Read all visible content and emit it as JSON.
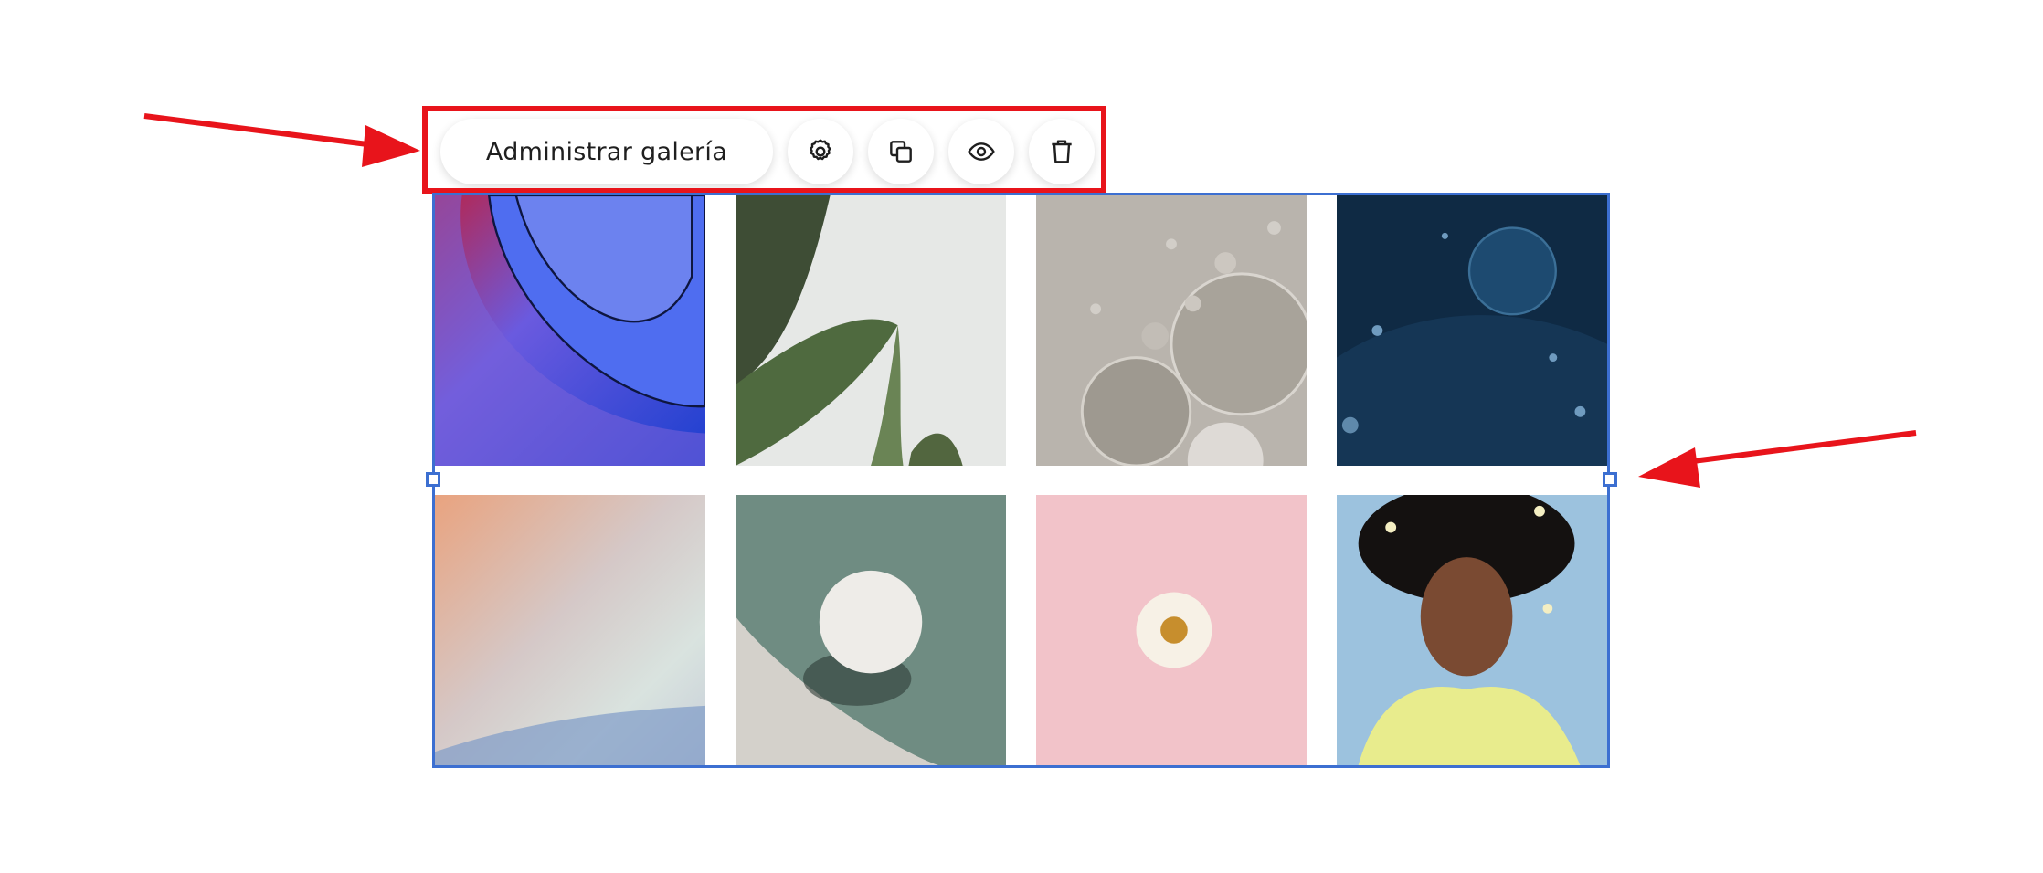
{
  "toolbar": {
    "manage_gallery_label": "Administrar galería",
    "buttons": [
      {
        "name": "settings",
        "icon": "gear-icon"
      },
      {
        "name": "duplicate",
        "icon": "copy-icon"
      },
      {
        "name": "preview",
        "icon": "eye-icon"
      },
      {
        "name": "delete",
        "icon": "trash-icon"
      }
    ]
  },
  "gallery": {
    "columns": 4,
    "rows": 2,
    "images": [
      {
        "subject": "blue-purple abstract curves"
      },
      {
        "subject": "banana leaves on white"
      },
      {
        "subject": "oil bubbles grey"
      },
      {
        "subject": "dark blue bubbles"
      },
      {
        "subject": "pastel gradient"
      },
      {
        "subject": "white sphere on green tiles"
      },
      {
        "subject": "white flower on pink"
      },
      {
        "subject": "woman with flowers in hair"
      }
    ]
  },
  "annotations": {
    "highlight_color": "#e8141b",
    "selection_color": "#3c6fd1"
  }
}
